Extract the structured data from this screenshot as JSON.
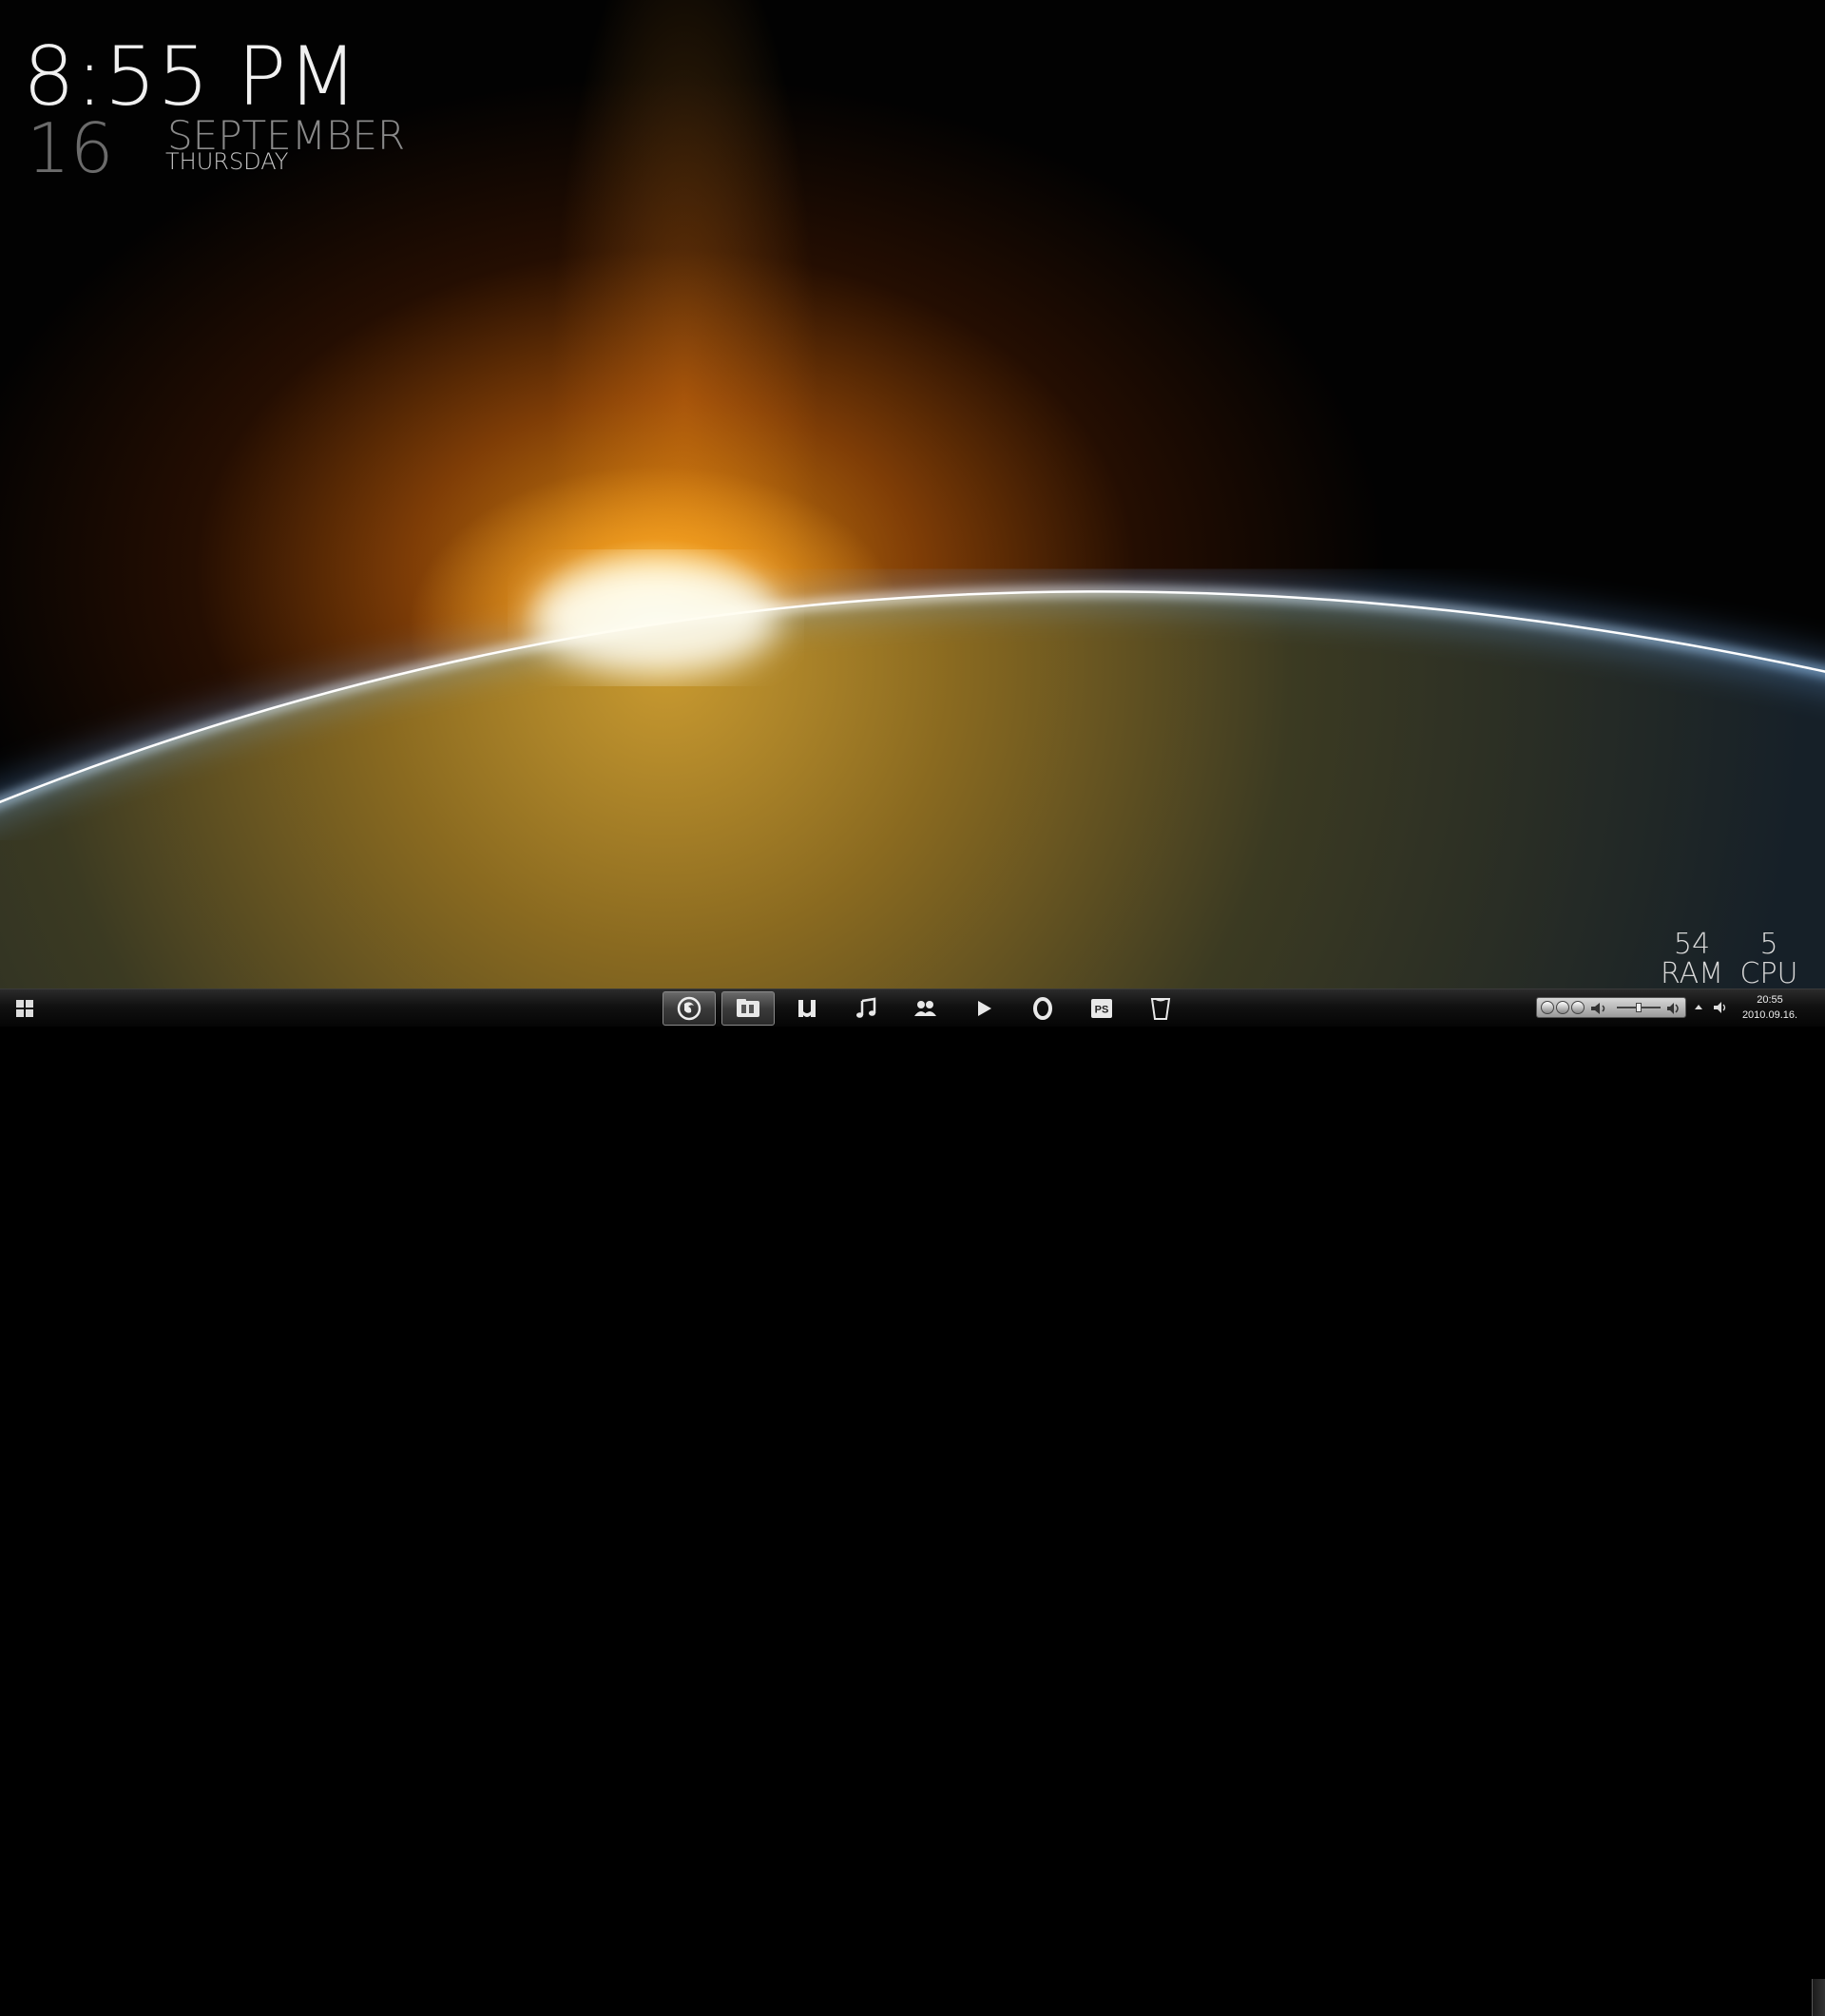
{
  "desktop": {
    "clock": {
      "time": "8:55 PM",
      "day": "16",
      "month": "SEPTEMBER",
      "weekday": "THURSDAY"
    },
    "stats": {
      "ram_value": "54",
      "ram_label": "RAM",
      "cpu_value": "5",
      "cpu_label": "CPU"
    }
  },
  "taskbar": {
    "start_icon": "windows-logo-icon",
    "pinned": [
      {
        "name": "firefox",
        "icon": "firefox-icon",
        "active": true
      },
      {
        "name": "explorer",
        "icon": "explorer-icon",
        "active": true
      },
      {
        "name": "utorrent",
        "icon": "utorrent-icon",
        "active": false
      },
      {
        "name": "music",
        "icon": "music-note-icon",
        "active": false
      },
      {
        "name": "messenger",
        "icon": "people-icon",
        "active": false
      },
      {
        "name": "media-player",
        "icon": "play-icon",
        "active": false
      },
      {
        "name": "opera",
        "icon": "opera-icon",
        "active": false
      },
      {
        "name": "photoshop",
        "icon": "photoshop-icon",
        "active": false,
        "label": "PS"
      },
      {
        "name": "recycle-bin",
        "icon": "recycle-bin-icon",
        "active": false
      }
    ],
    "media_control": {
      "icons": [
        "previous-icon",
        "pause-icon",
        "next-icon",
        "volume-icon"
      ]
    },
    "tray": {
      "time": "20:55",
      "date": "2010.09.16."
    }
  },
  "colors": {
    "sun_core": "#fffbe8",
    "sun_glow": "#ff9a10",
    "atmosphere": "#4aa0ff",
    "earth_warm": "#8a6a20",
    "earth_cool": "#1f2b34"
  }
}
